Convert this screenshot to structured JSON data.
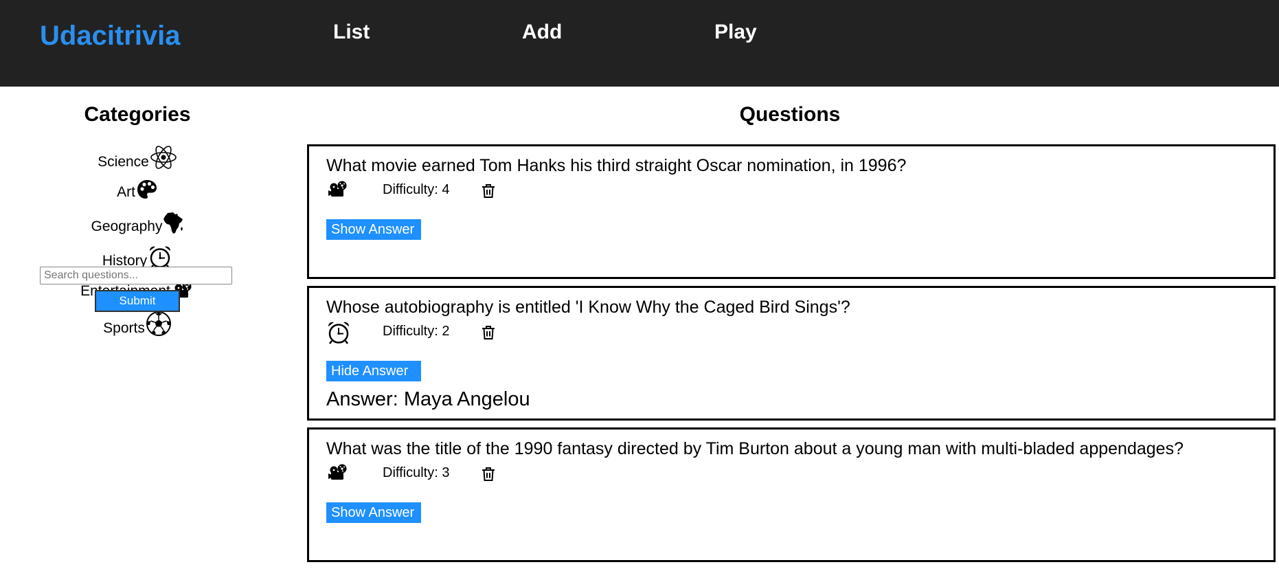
{
  "header": {
    "brand": "Udacitrivia",
    "nav": [
      "List",
      "Add",
      "Play"
    ]
  },
  "sidebar": {
    "title": "Categories",
    "categories": [
      {
        "label": "Science",
        "icon": "science-icon"
      },
      {
        "label": "Art",
        "icon": "art-icon"
      },
      {
        "label": "Geography",
        "icon": "geography-icon"
      },
      {
        "label": "History",
        "icon": "history-icon"
      },
      {
        "label": "Entertainment",
        "icon": "entertainment-icon"
      },
      {
        "label": "Sports",
        "icon": "sports-icon"
      }
    ],
    "search_placeholder": "Search questions...",
    "submit_label": "Submit"
  },
  "main": {
    "title": "Questions",
    "questions": [
      {
        "text": "What movie earned Tom Hanks his third straight Oscar nomination, in 1996?",
        "category_icon": "entertainment-icon",
        "difficulty": "Difficulty: 4",
        "button": "Show Answer",
        "answer": ""
      },
      {
        "text": "Whose autobiography is entitled 'I Know Why the Caged Bird Sings'?",
        "category_icon": "history-icon",
        "difficulty": "Difficulty: 2",
        "button": "Hide Answer",
        "answer": "Answer: Maya Angelou"
      },
      {
        "text": "What was the title of the 1990 fantasy directed by Tim Burton about a young man with multi-bladed appendages?",
        "category_icon": "entertainment-icon",
        "difficulty": "Difficulty: 3",
        "button": "Show Answer",
        "answer": ""
      }
    ]
  },
  "colors": {
    "header_bg": "#222222",
    "brand": "#2a8ff0",
    "button": "#1e90ff"
  }
}
